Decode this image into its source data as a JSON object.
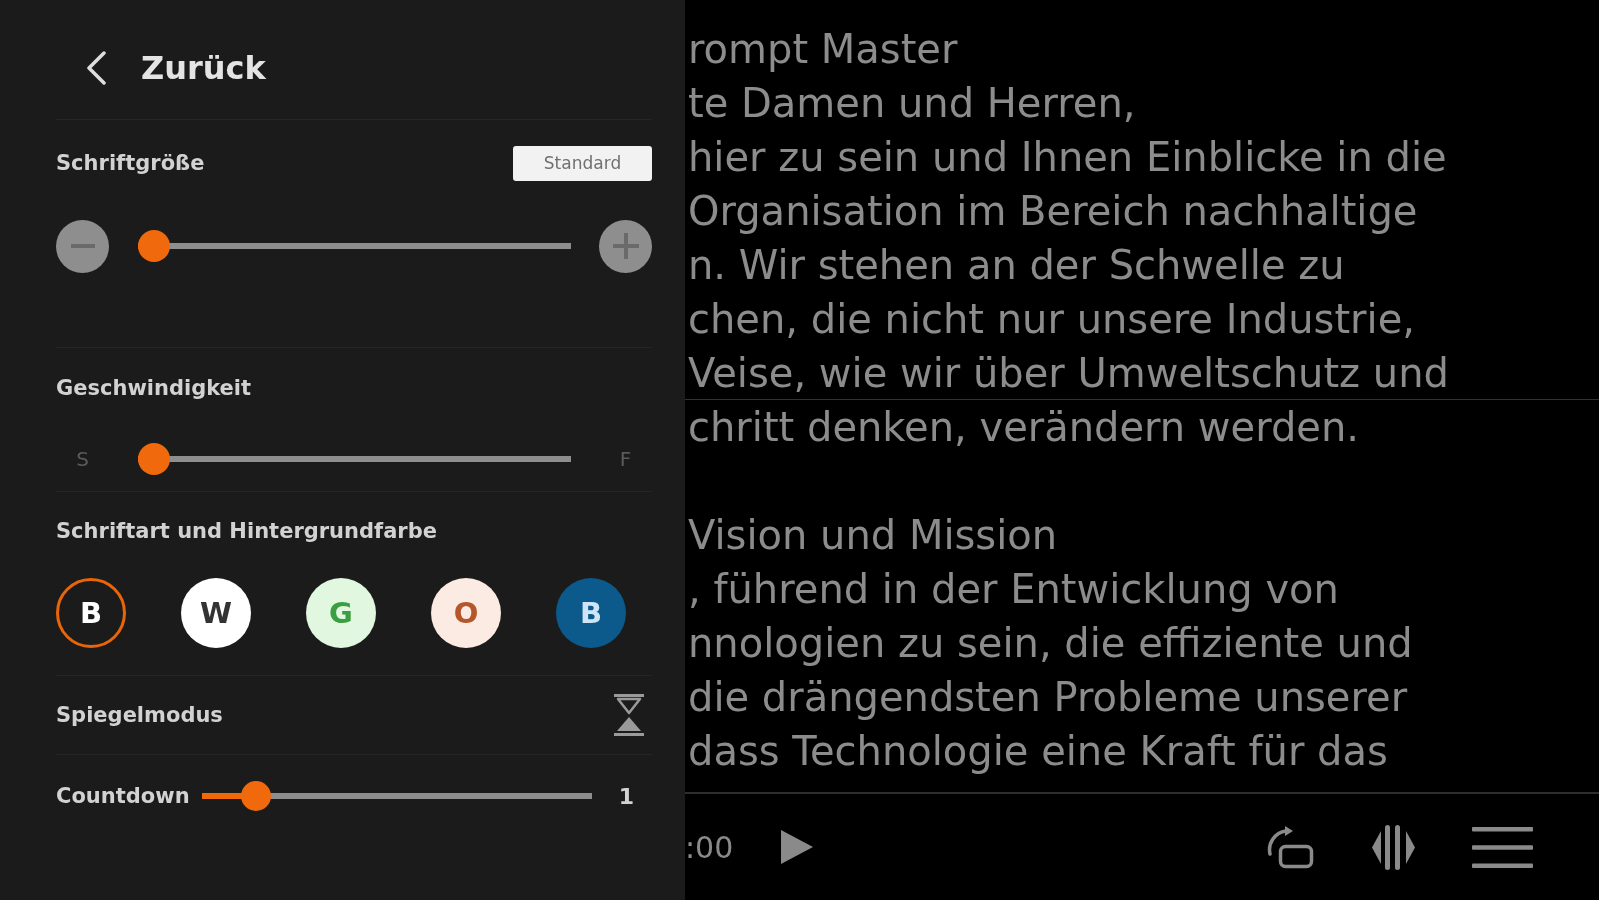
{
  "settings": {
    "back": {
      "label": "Zurück"
    },
    "font_size": {
      "label": "Schriftgröße",
      "reset_button": "Standard",
      "level": 0
    },
    "speed": {
      "label": "Geschwindigkeit",
      "min_label": "S",
      "max_label": "F",
      "level": 0
    },
    "appearance": {
      "label": "Schriftart und Hintergrundfarbe",
      "options": [
        {
          "letter": {
            "text": "B",
            "color": "#ffffff"
          },
          "color": "#1b1b1b",
          "selected": true
        },
        {
          "letter": {
            "text": "W",
            "color": "#333333"
          },
          "color": "#ffffff",
          "selected": false
        },
        {
          "letter": {
            "text": "G",
            "color": "#3a9e43"
          },
          "color": "#e2f7df",
          "selected": false
        },
        {
          "letter": {
            "text": "O",
            "color": "#b4572b"
          },
          "color": "#fbebe2",
          "selected": false
        },
        {
          "letter": {
            "text": "B",
            "color": "#cde5f7"
          },
          "color": "#0b5a8b",
          "selected": false
        }
      ]
    },
    "mirror_mode": {
      "label": "Spiegelmodus"
    },
    "countdown": {
      "label": "Countdown",
      "level": 0.11,
      "value": "1"
    }
  },
  "script": {
    "paragraphs": [
      {
        "lines": [
          "rompt Master",
          "te Damen und Herren,",
          "hier zu sein und Ihnen Einblicke in die",
          "Organisation im Bereich nachhaltige",
          "n. Wir stehen an der Schwelle zu",
          "chen, die nicht nur unsere Industrie,",
          "Veise, wie wir über Umweltschutz und",
          "chritt denken, verändern werden."
        ]
      },
      {
        "lines": [
          "Vision und Mission",
          ", führend in der Entwicklung von",
          "nnologien zu sein, die effiziente und",
          "die drängendsten Probleme unserer",
          "dass Technologie eine Kraft für das"
        ]
      }
    ]
  },
  "player_bar": {
    "time": ":00"
  }
}
